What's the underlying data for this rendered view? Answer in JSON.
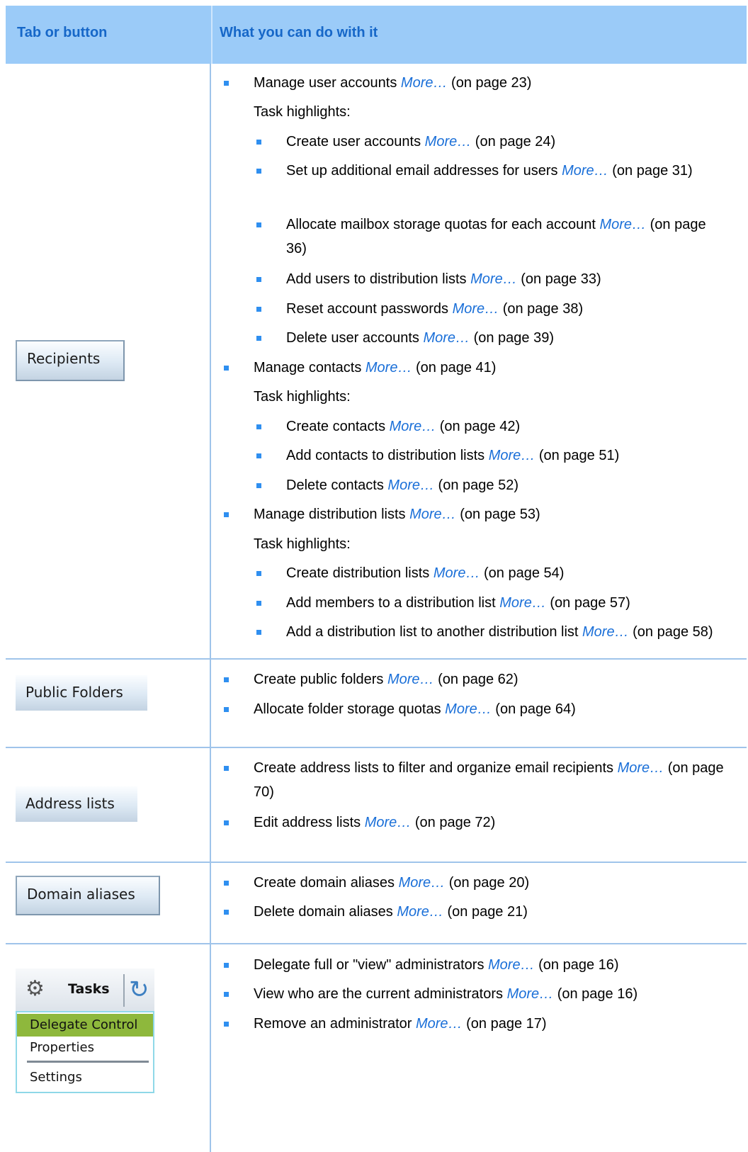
{
  "table": {
    "header": {
      "col1": "Tab or button",
      "col2": "What you can do with it"
    },
    "recipients": {
      "button_label": "Recipients",
      "items": [
        {
          "text": "Manage user accounts ",
          "more": "More…",
          "page": " (on page 23)"
        },
        {
          "text": "Create user accounts ",
          "more": "More…",
          "page": " (on page 24)"
        },
        {
          "text": "Set up additional email addresses for users ",
          "more": "More…",
          "page": " (on page 31)"
        },
        {
          "text": "Allocate mailbox storage quotas for each account  ",
          "more": "More…",
          "page": " (on page 36)"
        },
        {
          "text": "Add users to distribution lists ",
          "more": "More…",
          "page": " (on page 33)"
        },
        {
          "text": "Reset account passwords ",
          "more": "More…",
          "page": " (on page 38)"
        },
        {
          "text": "Delete user accounts ",
          "more": "More…",
          "page": " (on page 39)"
        },
        {
          "text": "Manage contacts ",
          "more": "More…",
          "page": " (on page 41)"
        },
        {
          "text": "Create contacts ",
          "more": "More…",
          "page": " (on page 42)"
        },
        {
          "text": "Add contacts to distribution lists ",
          "more": "More…",
          "page": " (on page 51)"
        },
        {
          "text": "Delete contacts ",
          "more": "More…",
          "page": " (on page 52)"
        },
        {
          "text": "Manage distribution lists ",
          "more": "More…",
          "page": " (on page 53)"
        },
        {
          "text": "Create distribution lists ",
          "more": "More…",
          "page": " (on page 54)"
        },
        {
          "text": "Add members to a distribution list ",
          "more": "More…",
          "page": " (on page 57)"
        },
        {
          "text": "Add a distribution list to another distribution list ",
          "more": "More…",
          "page": " (on page 58)"
        }
      ],
      "task_highlights": "Task highlights:"
    },
    "public_folders": {
      "button_label": "Public Folders",
      "items": [
        {
          "text": "Create public folders ",
          "more": "More…",
          "page": " (on page 62)"
        },
        {
          "text": "Allocate folder storage quotas ",
          "more": "More…",
          "page": " (on page 64)"
        }
      ]
    },
    "address_lists": {
      "button_label": "Address lists",
      "items": [
        {
          "text": "Create address lists to filter and organize email recipients ",
          "more": "More…",
          "page": " (on page 70)"
        },
        {
          "text": "Edit address lists ",
          "more": "More…",
          "page": " (on page 72)"
        }
      ]
    },
    "domain_aliases": {
      "button_label": "Domain aliases",
      "items": [
        {
          "text": "Create domain aliases ",
          "more": "More…",
          "page": " (on page 20)"
        },
        {
          "text": "Delete domain aliases ",
          "more": "More…",
          "page": " (on page 21)"
        }
      ]
    },
    "tasks": {
      "toolbar_label": "Tasks",
      "gear_icon": "gear-icon",
      "refresh_icon": "refresh-icon",
      "menu": [
        "Delegate Control",
        "Properties",
        "Settings"
      ],
      "items": [
        {
          "text": "Delegate full or \"view\" administrators ",
          "more": "More…",
          "page": " (on page 16)"
        },
        {
          "text": "View who are the current administrators ",
          "more": "More…",
          "page": " (on page 16)"
        },
        {
          "text": "Remove an administrator ",
          "more": "More…",
          "page": " (on page 17)"
        }
      ]
    }
  },
  "colors": {
    "header_bg": "#9bcbf8",
    "header_text": "#1667c8",
    "link": "#1a6fd8",
    "bullet": "#2f8ff0",
    "rule": "#9fc4ea",
    "menu_active": "#8eb83c"
  }
}
